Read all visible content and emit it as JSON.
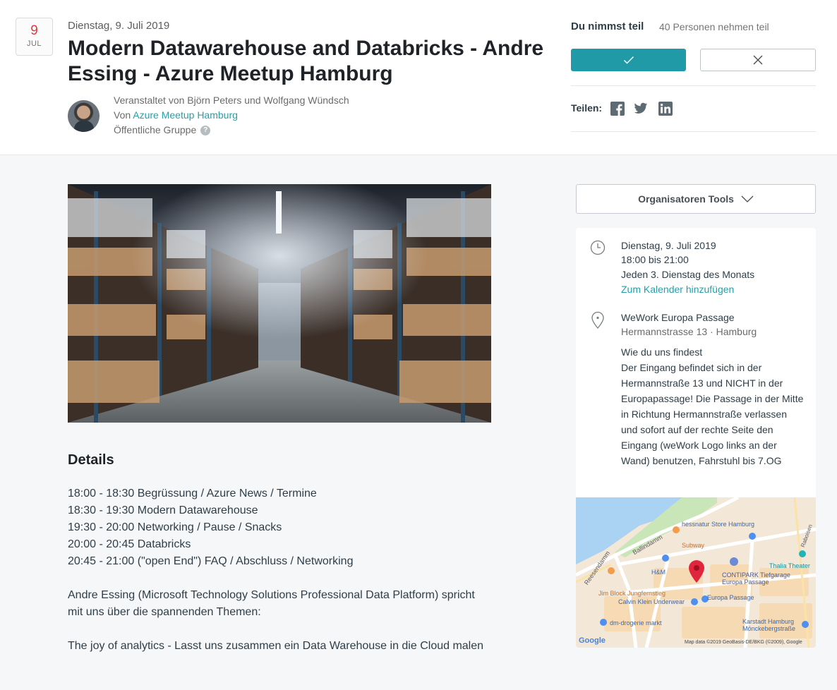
{
  "header": {
    "date_day": "9",
    "date_month": "JUL",
    "date_text": "Dienstag, 9. Juli 2019",
    "title": "Modern Datawarehouse and Databricks - Andre Essing - Azure Meetup Hamburg",
    "hosted_by": "Veranstaltet von Björn Peters und Wolfgang Wündsch",
    "from_prefix": "Von ",
    "group_name": "Azure Meetup Hamburg",
    "group_type": "Öffentliche Gruppe",
    "help_glyph": "?"
  },
  "rsvp": {
    "status_label": "Du nimmst teil",
    "attendee_count": "40 Personen nehmen teil",
    "share_label": "Teilen:"
  },
  "details": {
    "heading": "Details",
    "agenda": [
      "18:00 - 18:30 Begrüssung / Azure News / Termine",
      "18:30 - 19:30 Modern Datawarehouse",
      "19:30 - 20:00 Networking / Pause / Snacks",
      "20:00 - 20:45 Databricks",
      "20:45 - 21:00 (\"open End\") FAQ / Abschluss / Networking"
    ],
    "speaker_text": "Andre Essing (Microsoft Technology Solutions Professional Data Platform) spricht mit uns über die spannenden Themen:",
    "topic_text": "The joy of analytics - Lasst uns zusammen ein Data Warehouse in die Cloud malen"
  },
  "sidebar": {
    "org_tools_label": "Organisatoren Tools",
    "date_line": "Dienstag, 9. Juli 2019",
    "time_line": "18:00 bis 21:00",
    "recurrence": "Jeden 3. Dienstag des Monats",
    "calendar_link": "Zum Kalender hinzufügen",
    "venue_name": "WeWork Europa Passage",
    "venue_address": "Hermannstrasse 13 · Hamburg",
    "directions_title": "Wie du uns findest",
    "directions_text": "Der Eingang befindet sich in der Hermannstraße 13 und NICHT in der Europapassage! Die Passage in der Mitte in Richtung Hermannstraße verlassen und sofort auf der rechte Seite den Eingang (weWork Logo links an der Wand) benutzen, Fahrstuhl bis 7.OG"
  },
  "map": {
    "labels": {
      "hessnatur": "hessnatur Store Hamburg",
      "subway": "Subway",
      "ballindamm": "Ballindamm",
      "reesendamm": "Reesendamm",
      "hm": "H&M",
      "contipark": "CONTIPARK Tiefgarage",
      "contipark_sub": "Europa Passage",
      "thalia": "Thalia Theater",
      "jim_block": "Jim Block Jungfernstieg",
      "calvin_klein": "Calvin Klein Underwear",
      "europa_passage": "Europa Passage",
      "dm": "dm-drogerie markt",
      "karstadt": "Karstadt Hamburg",
      "karstadt_sub": "Mönckebergstraße",
      "raboisen": "Raboisen",
      "google": "Google",
      "attribution": "Map data ©2019 GeoBasis-DE/BKG (©2009), Google"
    }
  },
  "colors": {
    "accent": "#1f9aa6",
    "link": "#25a0a8",
    "date_red": "#e0393e",
    "pin": "#e0263d"
  }
}
